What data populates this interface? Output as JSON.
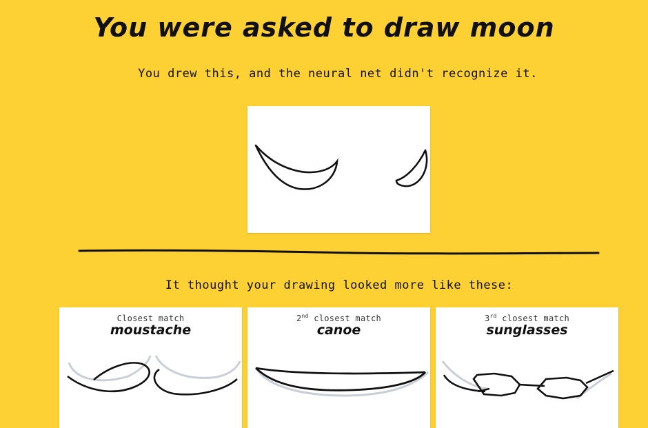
{
  "prompt": {
    "title": "You were asked to draw moon",
    "subtitle": "You drew this, and the neural net didn't recognize it."
  },
  "results": {
    "heading": "It thought your drawing looked more like these:",
    "matches": [
      {
        "rank_prefix": "",
        "rank_suffix": "",
        "rank_text": "Closest match",
        "label": "moustache"
      },
      {
        "rank_prefix": "2",
        "rank_suffix": "nd",
        "rank_text": " closest match",
        "label": "canoe"
      },
      {
        "rank_prefix": "3",
        "rank_suffix": "rd",
        "rank_text": " closest match",
        "label": "sunglasses"
      }
    ]
  },
  "colors": {
    "background": "#fdd034",
    "card": "#ffffff",
    "ink": "#111111",
    "ghost": "#c9cfd6"
  }
}
